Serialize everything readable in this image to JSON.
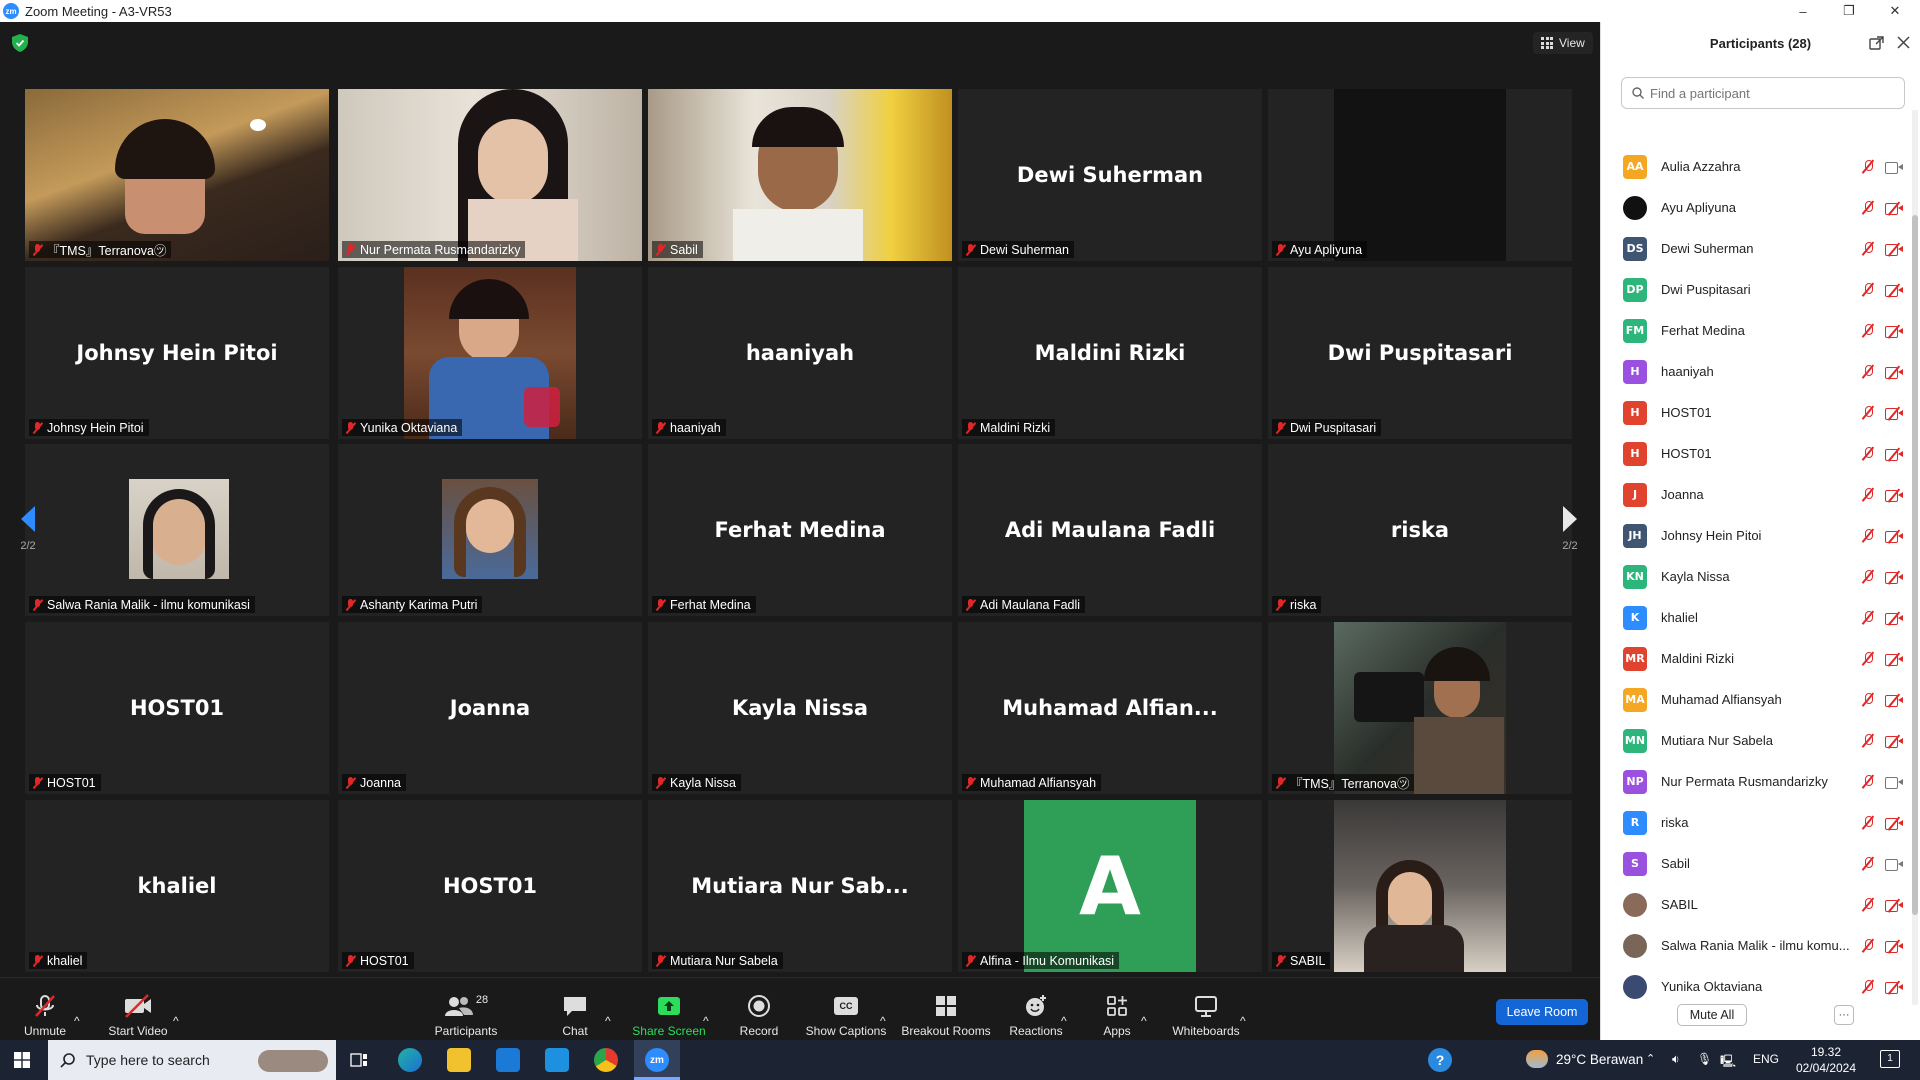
{
  "window": {
    "title": "Zoom Meeting - A3-VR53",
    "logo": "zm",
    "controls": [
      "–",
      "❐",
      "✕"
    ]
  },
  "meeting": {
    "view_label": "View",
    "page_indicator": "2/2",
    "tiles": [
      {
        "name": "『TMS』Terranova㋡",
        "video": true,
        "active": true
      },
      {
        "name": "Nur Permata Rusmandarizky",
        "video": true
      },
      {
        "name": "Sabil",
        "video": true
      },
      {
        "name": "Dewi Suherman",
        "display": "Dewi Suherman"
      },
      {
        "name": "Ayu Apliyuna",
        "video": true
      },
      {
        "name": "Johnsy Hein Pitoi",
        "display": "Johnsy Hein Pitoi"
      },
      {
        "name": "Yunika Oktaviana",
        "video": true
      },
      {
        "name": "haaniyah",
        "display": "haaniyah"
      },
      {
        "name": "Maldini Rizki",
        "display": "Maldini Rizki"
      },
      {
        "name": "Dwi Puspitasari",
        "display": "Dwi Puspitasari"
      },
      {
        "name": "Salwa Rania Malik - ilmu komunikasi",
        "video": true
      },
      {
        "name": "Ashanty Karima Putri",
        "video": true
      },
      {
        "name": "Ferhat Medina",
        "display": "Ferhat Medina"
      },
      {
        "name": "Adi Maulana Fadli",
        "display": "Adi Maulana Fadli"
      },
      {
        "name": "riska",
        "display": "riska"
      },
      {
        "name": "HOST01",
        "display": "HOST01"
      },
      {
        "name": "Joanna",
        "display": "Joanna"
      },
      {
        "name": "Kayla Nissa",
        "display": "Kayla Nissa"
      },
      {
        "name": "Muhamad Alfiansyah",
        "display": "Muhamad  Alfian..."
      },
      {
        "name": "『TMS』Terranova㋡",
        "video": true
      },
      {
        "name": "khaliel",
        "display": "khaliel"
      },
      {
        "name": "HOST01",
        "display": "HOST01"
      },
      {
        "name": "Mutiara Nur Sabela",
        "display": "Mutiara Nur Sab..."
      },
      {
        "name": "Alfina - Ilmu Komunikasi",
        "initial": "A"
      },
      {
        "name": "SABIL",
        "video": true
      }
    ]
  },
  "toolbar": {
    "unmute": "Unmute",
    "start_video": "Start Video",
    "participants": "Participants",
    "participants_count": "28",
    "chat": "Chat",
    "share_screen": "Share Screen",
    "record": "Record",
    "show_captions": "Show Captions",
    "captions_badge": "CC",
    "breakout_rooms": "Breakout Rooms",
    "reactions": "Reactions",
    "apps": "Apps",
    "whiteboards": "Whiteboards",
    "leave_room": "Leave Room"
  },
  "panel": {
    "title": "Participants (28)",
    "search_placeholder": "Find a participant",
    "mute_all": "Mute All",
    "more": "···",
    "participants": [
      {
        "initials": "AA",
        "name": "Aulia Azzahra",
        "color": "#F5A623",
        "video_on": true
      },
      {
        "initials": "",
        "name": "Ayu Apliyuna",
        "color": "#111111",
        "video_on": false
      },
      {
        "initials": "DS",
        "name": "Dewi Suherman",
        "color": "#3F5571",
        "video_on": false
      },
      {
        "initials": "DP",
        "name": "Dwi Puspitasari",
        "color": "#2DB67C",
        "video_on": false
      },
      {
        "initials": "FM",
        "name": "Ferhat Medina",
        "color": "#2DB67C",
        "video_on": false
      },
      {
        "initials": "H",
        "name": "haaniyah",
        "color": "#9B51E0",
        "video_on": false
      },
      {
        "initials": "H",
        "name": "HOST01",
        "color": "#E0442E",
        "video_on": false
      },
      {
        "initials": "H",
        "name": "HOST01",
        "color": "#E0442E",
        "video_on": false
      },
      {
        "initials": "J",
        "name": "Joanna",
        "color": "#E0442E",
        "video_on": false
      },
      {
        "initials": "JH",
        "name": "Johnsy Hein Pitoi",
        "color": "#3F5571",
        "video_on": false
      },
      {
        "initials": "KN",
        "name": "Kayla Nissa",
        "color": "#2DB67C",
        "video_on": false
      },
      {
        "initials": "K",
        "name": "khaliel",
        "color": "#2D8CFF",
        "video_on": false
      },
      {
        "initials": "MR",
        "name": "Maldini Rizki",
        "color": "#E0442E",
        "video_on": false
      },
      {
        "initials": "MA",
        "name": "Muhamad Alfiansyah",
        "color": "#F5A623",
        "video_on": false
      },
      {
        "initials": "MN",
        "name": "Mutiara Nur Sabela",
        "color": "#2DB67C",
        "video_on": false
      },
      {
        "initials": "NP",
        "name": "Nur Permata Rusmandarizky",
        "color": "#9B51E0",
        "video_on": true
      },
      {
        "initials": "R",
        "name": "riska",
        "color": "#2D8CFF",
        "video_on": false
      },
      {
        "initials": "S",
        "name": "Sabil",
        "color": "#9B51E0",
        "video_on": true
      },
      {
        "initials": "",
        "name": "SABIL",
        "color": "#8a6a5a",
        "video_on": false
      },
      {
        "initials": "",
        "name": "Salwa Rania Malik - ilmu komu...",
        "color": "#7a6658",
        "video_on": false
      },
      {
        "initials": "",
        "name": "Yunika Oktaviana",
        "color": "#3a4a70",
        "video_on": false
      }
    ]
  },
  "taskbar": {
    "search_placeholder": "Type here to search",
    "weather": "29°C  Berawan",
    "language": "ENG",
    "time": "19.32",
    "date": "02/04/2024",
    "notification_count": "1"
  }
}
